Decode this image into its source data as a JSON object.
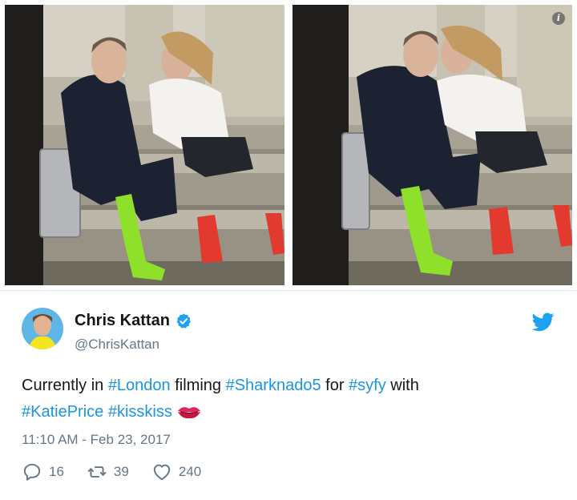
{
  "tweet": {
    "display_name": "Chris Kattan",
    "handle": "@ChrisKattan",
    "verified": true,
    "text_parts": [
      {
        "text": "Currently in ",
        "type": "text"
      },
      {
        "text": "#London",
        "type": "hashtag"
      },
      {
        "text": " filming ",
        "type": "text"
      },
      {
        "text": "#Sharknado5",
        "type": "hashtag"
      },
      {
        "text": " for ",
        "type": "text"
      },
      {
        "text": "#syfy",
        "type": "hashtag"
      },
      {
        "text": " with ",
        "type": "text"
      },
      {
        "text": "#KatiePrice",
        "type": "hashtag"
      },
      {
        "text": " ",
        "type": "text"
      },
      {
        "text": "#kisskiss",
        "type": "hashtag"
      }
    ],
    "emoji": "kiss-mark",
    "timestamp": "11:10 AM - Feb 23, 2017",
    "stats": {
      "replies": "16",
      "retweets": "39",
      "likes": "240"
    }
  },
  "media": {
    "count": 2,
    "info_badge": "i"
  },
  "icons": {
    "verified": "verified-badge-icon",
    "bird": "twitter-bird-icon",
    "reply": "reply-icon",
    "retweet": "retweet-icon",
    "like": "heart-icon",
    "emoji": "kiss-mark-icon"
  },
  "colors": {
    "hashtag": "#1b95e0",
    "twitter_blue": "#1da1f2",
    "secondary_text": "#657786",
    "primary_text": "#14171a"
  }
}
